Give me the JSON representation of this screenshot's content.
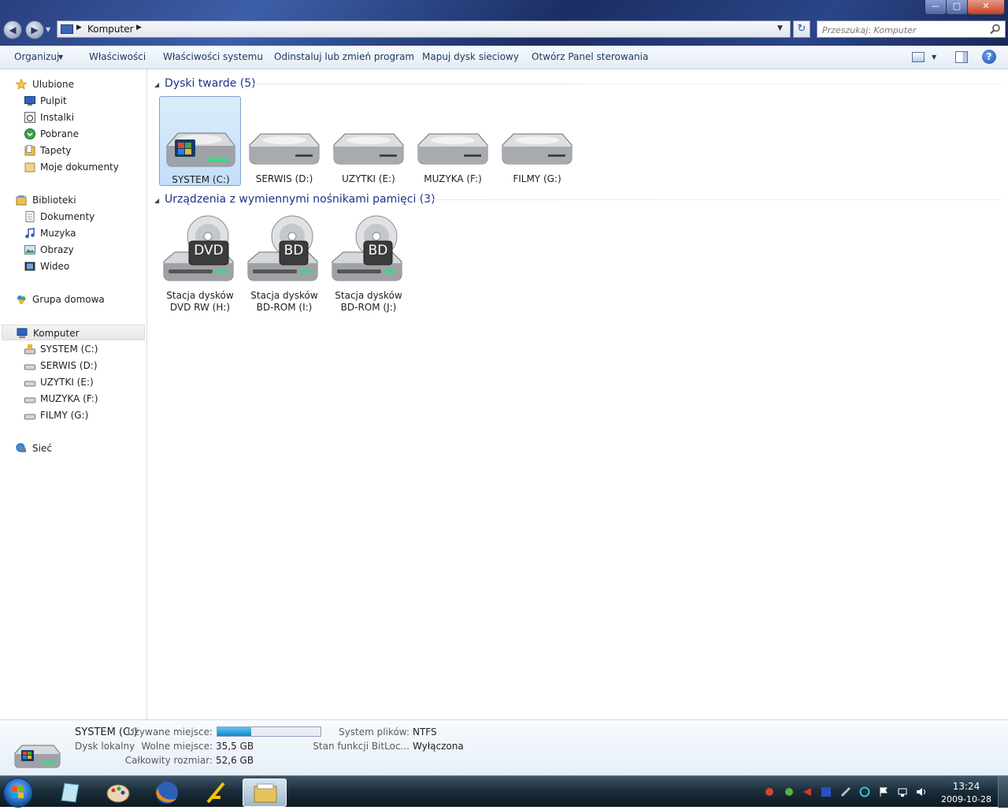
{
  "window": {
    "address_path": "Komputer",
    "search_placeholder": "Przeszukaj: Komputer"
  },
  "toolbar": {
    "organize": "Organizuj",
    "properties": "Właściwości",
    "system_properties": "Właściwości systemu",
    "uninstall": "Odinstaluj lub zmień program",
    "map_drive": "Mapuj dysk sieciowy",
    "control_panel": "Otwórz Panel sterowania"
  },
  "nav": {
    "favorites": {
      "label": "Ulubione",
      "items": [
        "Pulpit",
        "Instalki",
        "Pobrane",
        "Tapety",
        "Moje dokumenty"
      ]
    },
    "libraries": {
      "label": "Biblioteki",
      "items": [
        "Dokumenty",
        "Muzyka",
        "Obrazy",
        "Wideo"
      ]
    },
    "homegroup": "Grupa domowa",
    "computer": {
      "label": "Komputer",
      "items": [
        "SYSTEM (C:)",
        "SERWIS (D:)",
        "UZYTKI (E:)",
        "MUZYKA (F:)",
        "FILMY (G:)"
      ]
    },
    "network": "Sieć"
  },
  "groups": {
    "hdd": {
      "title": "Dyski twarde (5)",
      "drives": [
        "SYSTEM (C:)",
        "SERWIS (D:)",
        "UZYTKI (E:)",
        "MUZYKA (F:)",
        "FILMY (G:)"
      ]
    },
    "removable": {
      "title": "Urządzenia z wymiennymi nośnikami pamięci (3)",
      "drives": [
        {
          "line1": "Stacja dysków",
          "line2": "DVD RW (H:)",
          "badge": "DVD"
        },
        {
          "line1": "Stacja dysków",
          "line2": "BD-ROM (I:)",
          "badge": "BD"
        },
        {
          "line1": "Stacja dysków",
          "line2": "BD-ROM (J:)",
          "badge": "BD"
        }
      ]
    }
  },
  "details": {
    "name": "SYSTEM (C:)",
    "type": "Dysk lokalny",
    "used_label": "Używane miejsce:",
    "used_fraction": 0.33,
    "free_label": "Wolne miejsce:",
    "free_value": "35,5 GB",
    "total_label": "Całkowity rozmiar:",
    "total_value": "52,6 GB",
    "fs_label": "System plików:",
    "fs_value": "NTFS",
    "bitlocker_label": "Stan funkcji BitLoc...",
    "bitlocker_value": "Wyłączona"
  },
  "taskbar": {
    "time": "13:24",
    "date": "2009-10-28"
  }
}
